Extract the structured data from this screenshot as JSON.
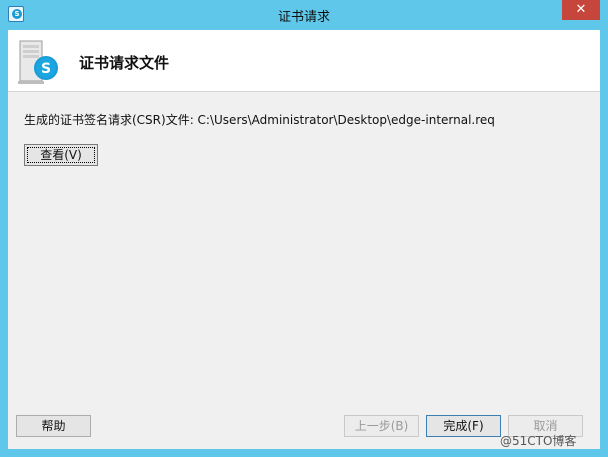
{
  "window": {
    "title": "证书请求",
    "close_label": "✕"
  },
  "header": {
    "title": "证书请求文件"
  },
  "main": {
    "info_text": "生成的证书签名请求(CSR)文件: C:\\Users\\Administrator\\Desktop\\edge-internal.req",
    "view_button": "查看(V)"
  },
  "footer": {
    "help_button": "帮助",
    "back_button": "上一步(B)",
    "finish_button": "完成(F)",
    "cancel_button": "取消"
  },
  "watermark": "@51CTO博客",
  "icons": {
    "app": "skype-icon",
    "header": "server-skype-icon"
  },
  "colors": {
    "frame": "#5fc8ea",
    "close": "#c7463c",
    "accent": "#1a9bd6"
  }
}
